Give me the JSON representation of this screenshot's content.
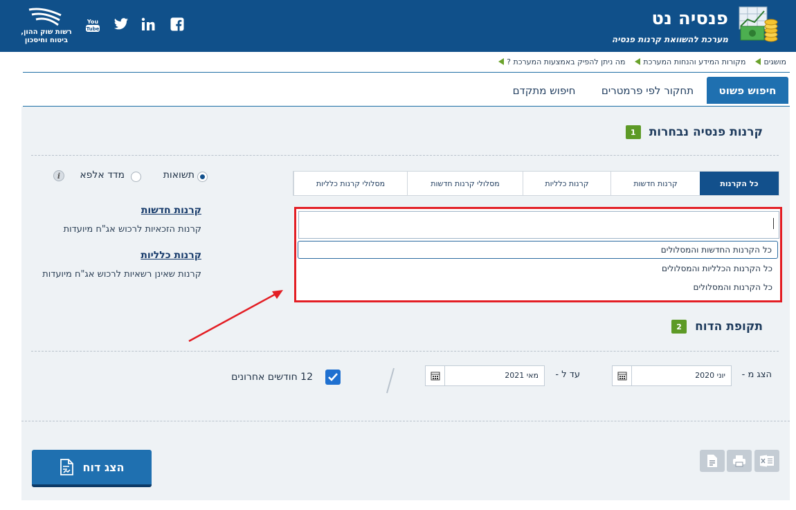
{
  "header": {
    "title": "פנסיה נט",
    "subtitle": "מערכת להשוואת קרנות פנסיה",
    "authority_line1": "רשות שוק ההון,",
    "authority_line2": "ביטוח וחיסכון",
    "social": [
      "facebook-icon",
      "linkedin-icon",
      "twitter-icon",
      "youtube-icon"
    ],
    "brand_color": "#10508a"
  },
  "top_links": [
    {
      "label": "מה ניתן להפיק באמצעות המערכת ?"
    },
    {
      "label": "מקורות המידע והנחות המערכת"
    },
    {
      "label": "מושגים"
    }
  ],
  "main_tabs": [
    {
      "label": "חיפוש פשוט",
      "active": true
    },
    {
      "label": "תחקור לפי פרמטרים",
      "active": false
    },
    {
      "label": "חיפוש מתקדם",
      "active": false
    }
  ],
  "section1": {
    "number": "1",
    "title": "קרנות פנסיה נבחרות"
  },
  "fund_tabs": [
    {
      "label": "כל הקרנות",
      "active": true
    },
    {
      "label": "קרנות חדשות",
      "active": false
    },
    {
      "label": "קרנות כלליות",
      "active": false
    },
    {
      "label": "מסלולי קרנות חדשות",
      "active": false
    },
    {
      "label": "מסלולי קרנות כלליות",
      "active": false
    }
  ],
  "dropdown": {
    "value": "",
    "options": [
      {
        "label": "כל הקרנות החדשות והמסלולים",
        "highlighted": true
      },
      {
        "label": "כל הקרנות הכלליות והמסלולים",
        "highlighted": false
      },
      {
        "label": "כל הקרנות והמסלולים",
        "highlighted": false
      }
    ]
  },
  "metric_radios": [
    {
      "label": "תשואות",
      "selected": true
    },
    {
      "label": "מדד אלפא",
      "selected": false
    }
  ],
  "notes": [
    {
      "heading": "קרנות חדשות",
      "text": "קרנות הזכאיות לרכוש אג\"ח מיועדות"
    },
    {
      "heading": "קרנות כלליות",
      "text": "קרנות שאינן רשאיות לרכוש אג\"ח מיועדות"
    }
  ],
  "section2": {
    "number": "2",
    "title": "תקופת הדוח"
  },
  "period": {
    "from_label": "הצג מ -",
    "from_value": "יוני 2020",
    "to_label": "עד ל -",
    "to_value": "מאי 2021",
    "last12_label": "12 חודשים אחרונים",
    "last12_checked": true
  },
  "actions": {
    "show_report": "הצג דוח",
    "exports": [
      "excel-icon",
      "print-icon",
      "document-icon"
    ]
  }
}
